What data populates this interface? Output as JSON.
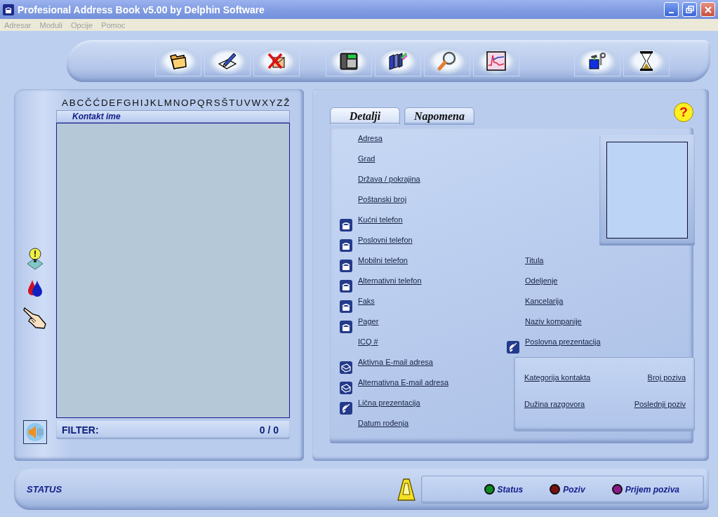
{
  "window": {
    "title": "Profesional Address Book v5.00 by Delphin Software"
  },
  "menu": [
    {
      "label": "Adresar",
      "disabled": true
    },
    {
      "label": "Moduli",
      "disabled": true
    },
    {
      "label": "Opcije",
      "disabled": true
    },
    {
      "label": "Pomoc",
      "disabled": true
    }
  ],
  "toolbar": {
    "groups": [
      {
        "buttons": [
          {
            "kind": "folder"
          },
          {
            "kind": "edit"
          },
          {
            "kind": "delete"
          }
        ]
      },
      {
        "buttons": [
          {
            "kind": "phone"
          },
          {
            "kind": "books"
          },
          {
            "kind": "search"
          },
          {
            "kind": "chart"
          }
        ]
      },
      {
        "buttons": [
          {
            "kind": "tools"
          },
          {
            "kind": "hourglass"
          }
        ]
      }
    ]
  },
  "side_tools": [
    {
      "kind": "bulb"
    },
    {
      "kind": "drops"
    },
    {
      "kind": "hand"
    }
  ],
  "contacts": {
    "letters": [
      "A",
      "B",
      "C",
      "Č",
      "Ć",
      "D",
      "E",
      "F",
      "G",
      "H",
      "I",
      "J",
      "K",
      "L",
      "M",
      "N",
      "O",
      "P",
      "Q",
      "R",
      "S",
      "Š",
      "T",
      "U",
      "V",
      "W",
      "X",
      "Y",
      "Z",
      "Ž"
    ],
    "column": "Kontakt ime",
    "filter_label": "FILTER:",
    "count": "0 / 0"
  },
  "tabs": [
    {
      "label": "Detalji",
      "selected": true
    },
    {
      "label": "Napomena",
      "selected": false
    }
  ],
  "help": {
    "label": "?"
  },
  "fields": [
    {
      "label": "Adresa",
      "kind": "plain"
    },
    {
      "label": "Grad",
      "kind": "plain"
    },
    {
      "label": "Država / pokrajina",
      "kind": "plain"
    },
    {
      "label": "Poštanski broj",
      "kind": "plain"
    },
    {
      "label": "Kućni telefon",
      "kind": "phone"
    },
    {
      "label": "Poslovni telefon",
      "kind": "phone"
    },
    {
      "label": "Mobilni telefon",
      "kind": "phone"
    },
    {
      "label": "Alternativni telefon",
      "kind": "phone"
    },
    {
      "label": "Faks",
      "kind": "phone"
    },
    {
      "label": "Pager",
      "kind": "phone"
    },
    {
      "label": "ICQ #",
      "kind": "plain"
    },
    {
      "label": "Aktivna E-mail adresa",
      "kind": "mail"
    },
    {
      "label": "Alternativna E-mail adresa",
      "kind": "mail"
    },
    {
      "label": "Lična prezentacija",
      "kind": "web"
    },
    {
      "label": "Datum rođenja",
      "kind": "plain"
    }
  ],
  "right_fields": [
    {
      "label": "Titula",
      "kind": "plain"
    },
    {
      "label": "Odeljenje",
      "kind": "plain"
    },
    {
      "label": "Kancelarija",
      "kind": "plain"
    },
    {
      "label": "Naziv kompanije",
      "kind": "plain"
    },
    {
      "label": "Poslovna prezentacija",
      "kind": "web"
    }
  ],
  "stats": [
    "Kategorija kontakta",
    "Broj poziva",
    "Dužina razgovora",
    "Poslednji poziv"
  ],
  "status": {
    "label": "STATUS",
    "lights": [
      {
        "label": "Status",
        "color": "#0e8a24"
      },
      {
        "label": "Poziv",
        "color": "#7a1010"
      },
      {
        "label": "Prijem poziva",
        "color": "#8a1a8a"
      }
    ]
  }
}
